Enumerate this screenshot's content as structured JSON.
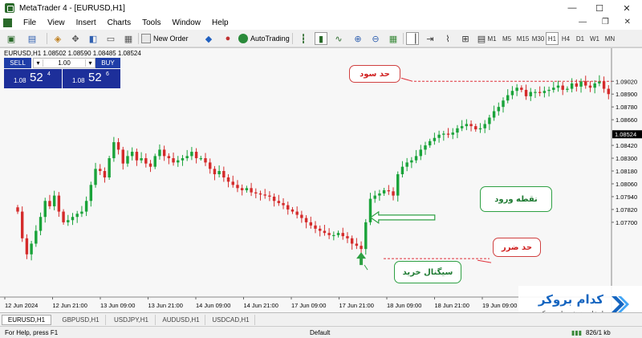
{
  "window": {
    "title": "MetaTrader 4 - [EURUSD,H1]",
    "minimize": "—",
    "maximize": "☐",
    "close": "✕"
  },
  "menu": {
    "items": [
      "File",
      "View",
      "Insert",
      "Charts",
      "Tools",
      "Window",
      "Help"
    ],
    "controls": "— ❐ ✕"
  },
  "toolbar": {
    "new_order": "New Order",
    "autotrading": "AutoTrading",
    "timeframes": [
      "M1",
      "M5",
      "M15",
      "M30",
      "H1",
      "H4",
      "D1",
      "W1",
      "MN"
    ],
    "active_timeframe": "H1"
  },
  "chart_header": "EURUSD,H1  1.08502 1.08590 1.08485 1.08524",
  "trade_panel": {
    "sell_label": "SELL",
    "buy_label": "BUY",
    "lot_value": "1.00",
    "sell_quote": {
      "prefix": "1.08",
      "big": "52",
      "sup": "4"
    },
    "buy_quote": {
      "prefix": "1.08",
      "big": "52",
      "sup": "6"
    }
  },
  "annotations": {
    "take_profit": "حد سود",
    "entry_point": "نقطه ورود",
    "stop_loss": "حد ضرر",
    "buy_signal": "سیگنال خرید"
  },
  "tabs": [
    "EURUSD,H1",
    "GBPUSD,H1",
    "USDJPY,H1",
    "AUDUSD,H1",
    "USDCAD,H1"
  ],
  "status": {
    "help": "For Help, press F1",
    "profile": "Default",
    "traffic": "826/1 kb"
  },
  "logo": {
    "name": "کدام بروکر",
    "tagline": "انتخاب هوشمندانه بروکر"
  },
  "colors": {
    "bull": "#1aa33a",
    "bear": "#d42b2b",
    "level_line": "#e0303a",
    "price_tag": "#000000"
  },
  "chart_data": {
    "type": "candlestick",
    "symbol": "EURUSD",
    "timeframe": "H1",
    "ylim": [
      1.07,
      1.093
    ],
    "y_ticks": [
      "1.09020",
      "1.08900",
      "1.08780",
      "1.08660",
      "1.08524",
      "1.08420",
      "1.08300",
      "1.08180",
      "1.08060",
      "1.07940",
      "1.07820",
      "1.07700"
    ],
    "x_ticks": [
      "12 Jun 2024",
      "12 Jun 21:00",
      "13 Jun 09:00",
      "13 Jun 21:00",
      "14 Jun 09:00",
      "14 Jun 21:00",
      "17 Jun 09:00",
      "17 Jun 21:00",
      "18 Jun 09:00",
      "18 Jun 21:00",
      "19 Jun 09:00"
    ],
    "current_price": "1.08524",
    "take_profit_level": 1.0902,
    "stop_loss_level": 1.0736,
    "entry_index": 76,
    "closes": [
      1.078,
      1.0755,
      1.074,
      1.075,
      1.0762,
      1.0775,
      1.079,
      1.0785,
      1.0795,
      1.078,
      1.077,
      1.0772,
      1.0775,
      1.0778,
      1.078,
      1.079,
      1.0805,
      1.082,
      1.0818,
      1.0812,
      1.083,
      1.0845,
      1.0838,
      1.0825,
      1.0832,
      1.0836,
      1.0828,
      1.083,
      1.0825,
      1.0822,
      1.0832,
      1.0838,
      1.0832,
      1.083,
      1.0826,
      1.0828,
      1.083,
      1.0832,
      1.0836,
      1.083,
      1.083,
      1.0826,
      1.082,
      1.0815,
      1.0818,
      1.0812,
      1.0808,
      1.0805,
      1.0802,
      1.08,
      1.0802,
      1.0798,
      1.0797,
      1.0796,
      1.0795,
      1.0794,
      1.079,
      1.0788,
      1.0786,
      1.0782,
      1.078,
      1.0777,
      1.0774,
      1.077,
      1.0767,
      1.0764,
      1.0762,
      1.076,
      1.0758,
      1.0758,
      1.076,
      1.0757,
      1.0755,
      1.075,
      1.0748,
      1.0745,
      1.077,
      1.0792,
      1.0795,
      1.0797,
      1.08,
      1.0799,
      1.0795,
      1.0815,
      1.0822,
      1.0826,
      1.0828,
      1.0832,
      1.0838,
      1.0842,
      1.0846,
      1.0849,
      1.0852,
      1.0853,
      1.0852,
      1.0854,
      1.0858,
      1.086,
      1.0862,
      1.086,
      1.0857,
      1.0858,
      1.0862,
      1.0868,
      1.0874,
      1.0878,
      1.0884,
      1.0889,
      1.0893,
      1.0896,
      1.0894,
      1.0888,
      1.0892,
      1.0892,
      1.0891,
      1.0893,
      1.0894,
      1.0896,
      1.0898,
      1.0894,
      1.0895,
      1.09,
      1.0897,
      1.0902,
      1.0898,
      1.0896,
      1.09,
      1.0902,
      1.0895,
      1.089
    ]
  }
}
